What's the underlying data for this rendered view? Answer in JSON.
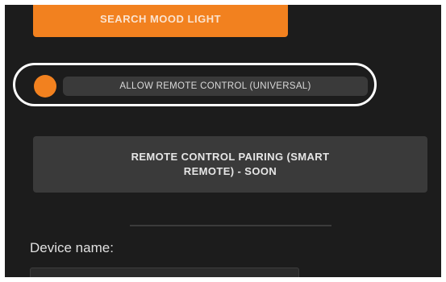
{
  "search_button": {
    "label": "SEARCH MOOD LIGHT"
  },
  "remote_toggle": {
    "label": "ALLOW REMOTE CONTROL (UNIVERSAL)"
  },
  "pairing_button": {
    "label": "REMOTE CONTROL PAIRING (SMART REMOTE) - SOON"
  },
  "device_name": {
    "label": "Device name:",
    "value": ""
  },
  "colors": {
    "accent": "#f2811f",
    "background": "#1c1c1c",
    "button_dark": "#3a3a3a",
    "highlight": "#ffffff"
  }
}
